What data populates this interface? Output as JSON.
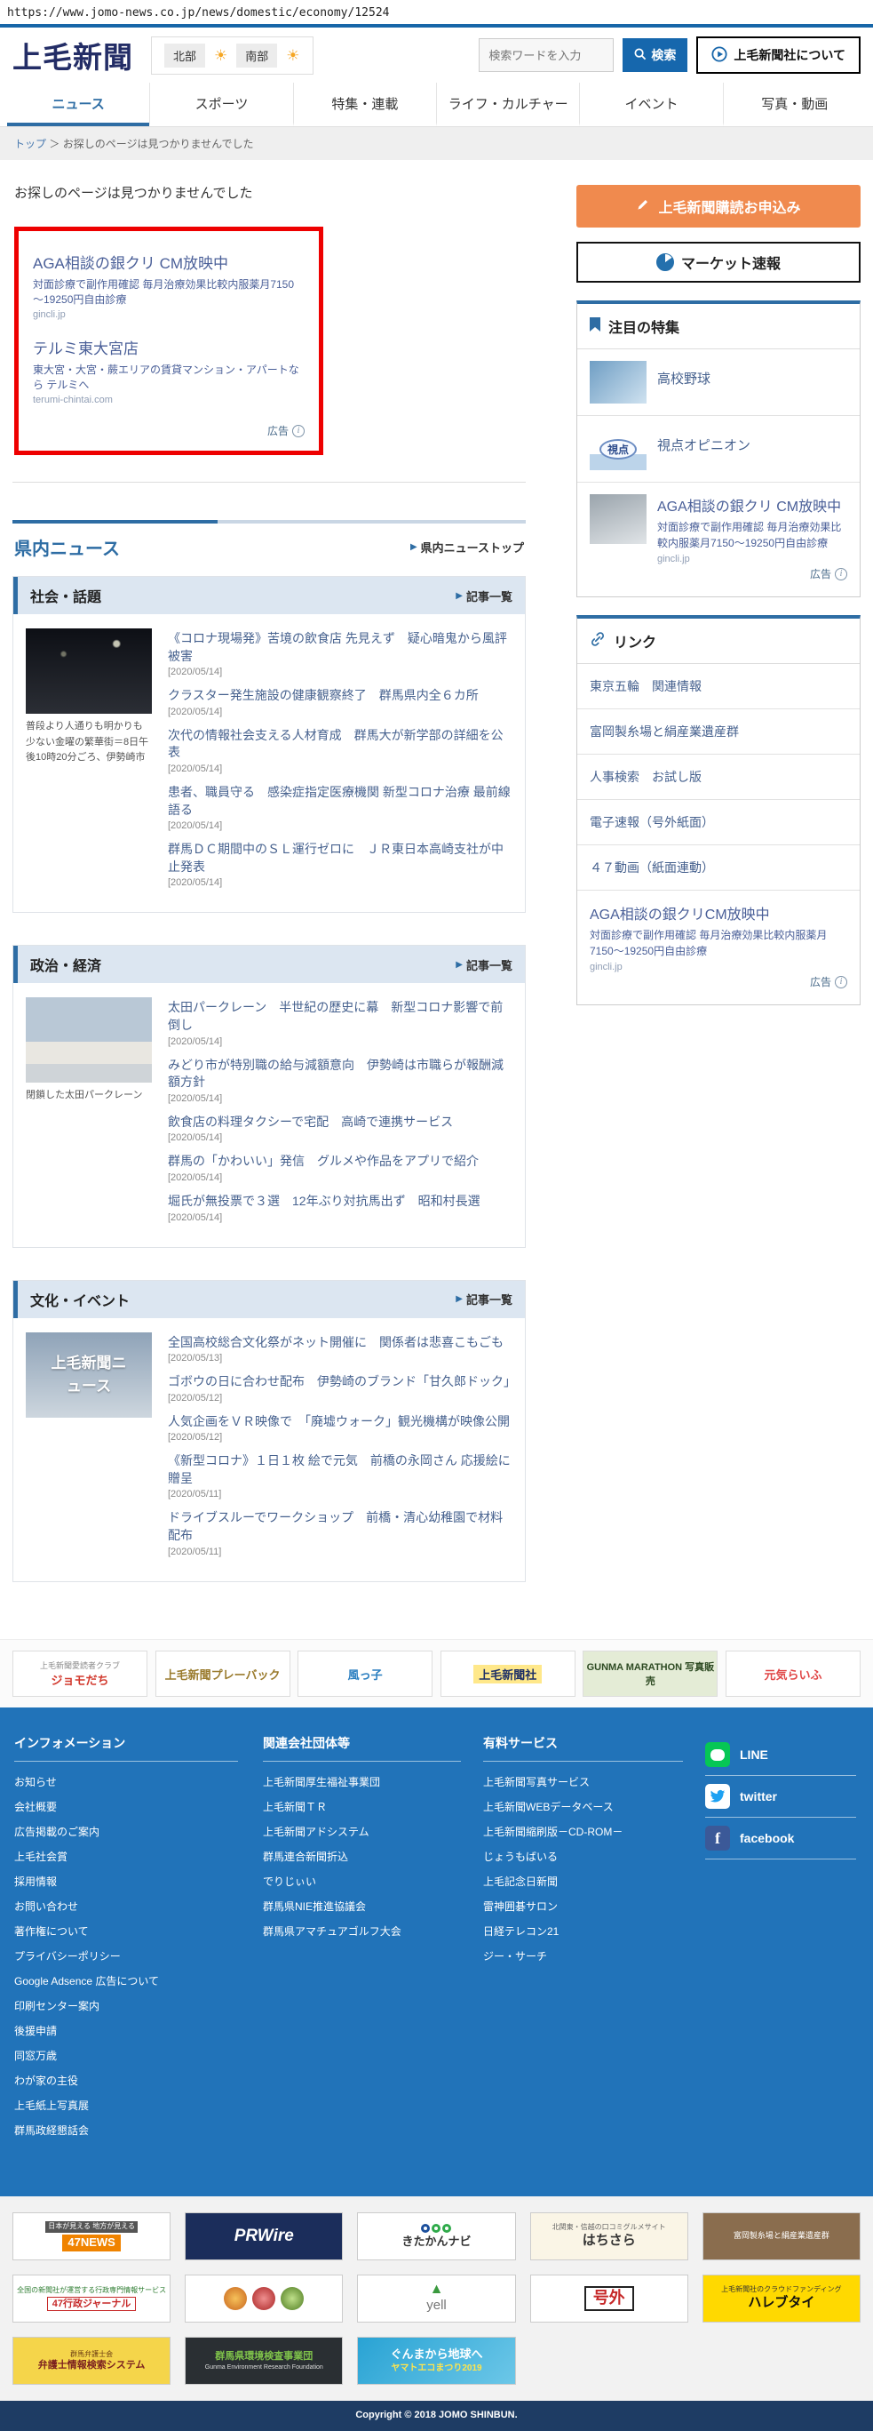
{
  "page": {
    "url": "https://www.jomo-news.co.jp/news/domestic/economy/12524",
    "copyright": "Copyright © 2018 JOMO SHINBUN."
  },
  "colors": {
    "accent_blue": "#2e6da4",
    "header_blue": "#1667ad",
    "footer_blue": "#2173b9",
    "subscribe_orange": "#f08a4e",
    "ad_border_red": "#ee0000",
    "line_green": "#06c755",
    "twitter_blue": "#1da1f2",
    "facebook_blue": "#3b5998"
  },
  "header": {
    "logo": "上毛新聞",
    "weather": {
      "north_label": "北部",
      "south_label": "南部",
      "sun": "☀"
    },
    "search_placeholder": "検索ワードを入力",
    "search_button": "検索",
    "about_button": "上毛新聞社について"
  },
  "nav": {
    "tabs": [
      "ニュース",
      "スポーツ",
      "特集・連載",
      "ライフ・カルチャー",
      "イベント",
      "写真・動画"
    ]
  },
  "breadcrumb": {
    "home": "トップ",
    "separator": "＞",
    "current": "お探しのページは見つかりませんでした"
  },
  "main": {
    "error_message": "お探しのページは見つかりませんでした",
    "ad_box": {
      "label": "広告",
      "ads": [
        {
          "title": "AGA相談の銀クリ CM放映中",
          "desc": "対面診療で副作用確認 毎月治療効果比較内服薬月7150～19250円自由診療",
          "url": "gincli.jp"
        },
        {
          "title": "テルミ東大宮店",
          "desc": "東大宮・大宮・蕨エリアの賃貸マンション・アパートなら テルミへ",
          "url": "terumi-chintai.com"
        }
      ]
    },
    "kennai": {
      "title": "県内ニュース",
      "top_link": "県内ニューストップ"
    },
    "sections": [
      {
        "title": "社会・話題",
        "more": "記事一覧",
        "thumb_label": "",
        "caption": "普段より人通りも明かりも少ない金曜の繁華街＝8日午後10時20分ごろ、伊勢崎市",
        "articles": [
          {
            "title": "《コロナ現場発》苦境の飲食店 先見えず　疑心暗鬼から風評被害",
            "date": "[2020/05/14]"
          },
          {
            "title": "クラスター発生施設の健康観察終了　群馬県内全６カ所",
            "date": "[2020/05/14]"
          },
          {
            "title": "次代の情報社会支える人材育成　群馬大が新学部の詳細を公表",
            "date": "[2020/05/14]"
          },
          {
            "title": "患者、職員守る　感染症指定医療機関 新型コロナ治療 最前線語る",
            "date": "[2020/05/14]"
          },
          {
            "title": "群馬ＤＣ期間中のＳＬ運行ゼロに　ＪＲ東日本高崎支社が中止発表",
            "date": "[2020/05/14]"
          }
        ]
      },
      {
        "title": "政治・経済",
        "more": "記事一覧",
        "thumb_label": "",
        "caption": "閉鎖した太田パークレーン",
        "articles": [
          {
            "title": "太田パークレーン　半世紀の歴史に幕　新型コロナ影響で前倒し",
            "date": "[2020/05/14]"
          },
          {
            "title": "みどり市が特別職の給与減額意向　伊勢崎は市職らが報酬減額方針",
            "date": "[2020/05/14]"
          },
          {
            "title": "飲食店の料理タクシーで宅配　高崎で連携サービス",
            "date": "[2020/05/14]"
          },
          {
            "title": "群馬の「かわいい」発信　グルメや作品をアプリで紹介",
            "date": "[2020/05/14]"
          },
          {
            "title": "堀氏が無投票で３選　12年ぶり対抗馬出ず　昭和村長選",
            "date": "[2020/05/14]"
          }
        ]
      },
      {
        "title": "文化・イベント",
        "more": "記事一覧",
        "thumb_label": "上毛新聞ニュース",
        "caption": "",
        "articles": [
          {
            "title": "全国高校総合文化祭がネット開催に　関係者は悲喜こもごも",
            "date": "[2020/05/13]"
          },
          {
            "title": "ゴボウの日に合わせ配布　伊勢崎のブランド「甘久郎ドック」",
            "date": "[2020/05/12]"
          },
          {
            "title": "人気企画をＶＲ映像で　「廃墟ウォーク」観光機構が映像公開",
            "date": "[2020/05/12]"
          },
          {
            "title": "《新型コロナ》１日１枚 絵で元気　前橋の永岡さん 応援絵に贈呈",
            "date": "[2020/05/11]"
          },
          {
            "title": "ドライブスルーでワークショップ　前橋・清心幼稚園で材料配布",
            "date": "[2020/05/11]"
          }
        ]
      }
    ]
  },
  "sidebar": {
    "subscribe_button": "上毛新聞購読お申込み",
    "market_button": "マーケット速報",
    "featured": {
      "title": "注目の特集",
      "items": [
        {
          "label": "高校野球"
        },
        {
          "label": "視点オピニオン",
          "thumb": "視点"
        }
      ],
      "ad": {
        "title": "AGA相談の銀クリ CM放映中",
        "desc": "対面診療で副作用確認 毎月治療効果比較内服薬月7150～19250円自由診療",
        "url": "gincli.jp",
        "label": "広告"
      }
    },
    "links": {
      "title": "リンク",
      "items": [
        "東京五輪　関連情報",
        "富岡製糸場と絹産業遺産群",
        "人事検索　お試し版",
        "電子速報（号外紙面）",
        "４７動画（紙面連動）"
      ],
      "ad": {
        "title": "AGA相談の銀クリCM放映中",
        "desc": "対面診療で副作用確認 毎月治療効果比較内服薬月7150～19250円自由診療",
        "url": "gincli.jp",
        "label": "広告"
      }
    }
  },
  "partners": [
    {
      "name": "ジョモだち",
      "sub": "上毛新聞愛読者クラブ"
    },
    {
      "name": "上毛新聞プレーバック",
      "sub": ""
    },
    {
      "name": "風っ子",
      "sub": ""
    },
    {
      "name": "上毛新聞社",
      "sub": ""
    },
    {
      "name": "GUNMA MARATHON 写真販売",
      "sub": ""
    },
    {
      "name": "元気らいふ",
      "sub": ""
    }
  ],
  "footer": {
    "columns": [
      {
        "title": "インフォメーション",
        "links": [
          "お知らせ",
          "会社概要",
          "広告掲載のご案内",
          "上毛社会賞",
          "採用情報",
          "お問い合わせ",
          "著作権について",
          "プライバシーポリシー",
          "Google Adsence 広告について",
          "印刷センター案内",
          "後援申請",
          "同窓万歳",
          "わが家の主役",
          "上毛紙上写真展",
          "群馬政経懇話会"
        ]
      },
      {
        "title": "関連会社団体等",
        "links": [
          "上毛新聞厚生福祉事業団",
          "上毛新聞ＴＲ",
          "上毛新聞アドシステム",
          "群馬連合新聞折込",
          "でりじぃい",
          "群馬県NIE推進協議会",
          "群馬県アマチュアゴルフ大会"
        ]
      },
      {
        "title": "有料サービス",
        "links": [
          "上毛新聞写真サービス",
          "上毛新聞WEBデータベース",
          "上毛新聞縮刷版－CD-ROM－",
          "じょうもばいる",
          "上毛記念日新聞",
          "雷神囲碁サロン",
          "日経テレコン21",
          "ジー・サーチ"
        ]
      }
    ],
    "social": [
      "LINE",
      "twitter",
      "facebook"
    ]
  },
  "banners": {
    "row1": [
      {
        "label": "47NEWS",
        "tagline": "日本が見える 地方が見える"
      },
      {
        "label": "PRWire",
        "tagline": ""
      },
      {
        "label": "きたかんナビ",
        "tagline": ""
      },
      {
        "label": "はちさら",
        "tagline": "北関東・信越の口コミグルメサイト"
      },
      {
        "label": "富岡製糸場と絹産業遺産群",
        "tagline": ""
      }
    ],
    "row2": [
      {
        "label": "47行政ジャーナル",
        "tagline": "全国の新聞社が運営する行政専門情報サービス"
      },
      {
        "label": "",
        "tagline": ""
      },
      {
        "label": "yell",
        "tagline": ""
      },
      {
        "label": "号外",
        "tagline": ""
      },
      {
        "label": "ハレブタイ",
        "tagline": "上毛新聞社のクラウドファンディング"
      }
    ],
    "row3": [
      {
        "label": "弁護士情報検索システム",
        "tagline": "群馬弁護士会"
      },
      {
        "label": "群馬県環境検査事業団",
        "tagline": "Gunma Environment Research Foundation"
      },
      {
        "label": "ぐんまから地球へ",
        "tagline": "ヤマトエコまつり2019"
      }
    ]
  }
}
